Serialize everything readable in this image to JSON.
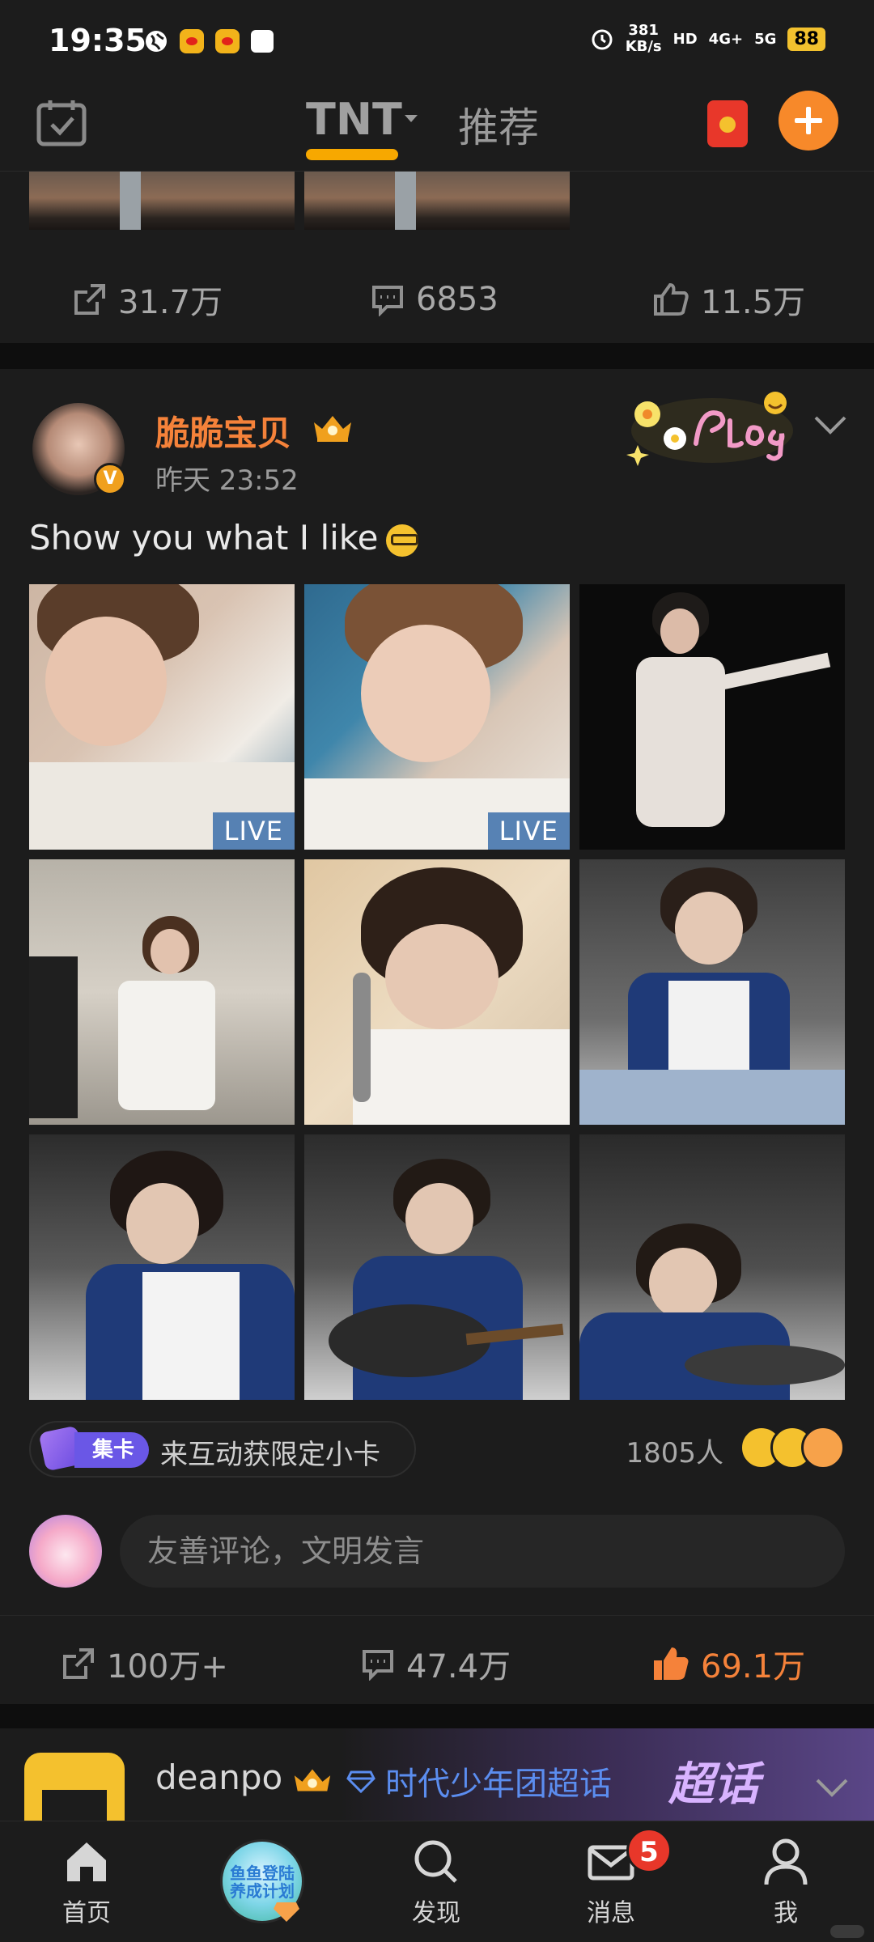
{
  "status_bar": {
    "time": "19:35",
    "speed_value": "381",
    "speed_unit": "KB/s",
    "hd": "HD",
    "sim1": "4G+",
    "sim2": "5G",
    "battery": "88"
  },
  "top_nav": {
    "tabs": [
      {
        "label": "TNT",
        "active": true
      },
      {
        "label": "推荐",
        "active": false
      }
    ],
    "accent": "#f7a800"
  },
  "prev_post": {
    "reposts": "31.7万",
    "comments": "6853",
    "likes": "11.5万"
  },
  "post": {
    "username": "脆脆宝贝",
    "time": "昨天 23:52",
    "text": "Show you what I like",
    "photos": [
      {
        "live": "LIVE"
      },
      {
        "live": "LIVE"
      },
      {},
      {},
      {},
      {},
      {},
      {},
      {}
    ],
    "collect": {
      "tag": "集卡",
      "text": "来互动获限定小卡",
      "people": "1805人"
    },
    "comment_placeholder": "友善评论，文明发言",
    "reposts": "100万+",
    "comments": "47.4万",
    "likes": "69.1万",
    "like_color": "#f5823a",
    "username_color": "#f5823a"
  },
  "next_post": {
    "username": "deanpo",
    "super_topic": "时代少年团超话",
    "chaohua": "超话"
  },
  "tab_bar": {
    "items": [
      {
        "label": "首页",
        "icon": "home-icon"
      },
      {
        "label": "",
        "icon": "activity-badge-icon"
      },
      {
        "label": "发现",
        "icon": "discover-icon"
      },
      {
        "label": "消息",
        "icon": "message-icon"
      },
      {
        "label": "我",
        "icon": "profile-icon"
      }
    ],
    "center_badge_text": "鱼鱼登陆养成计划",
    "message_count": "5"
  }
}
